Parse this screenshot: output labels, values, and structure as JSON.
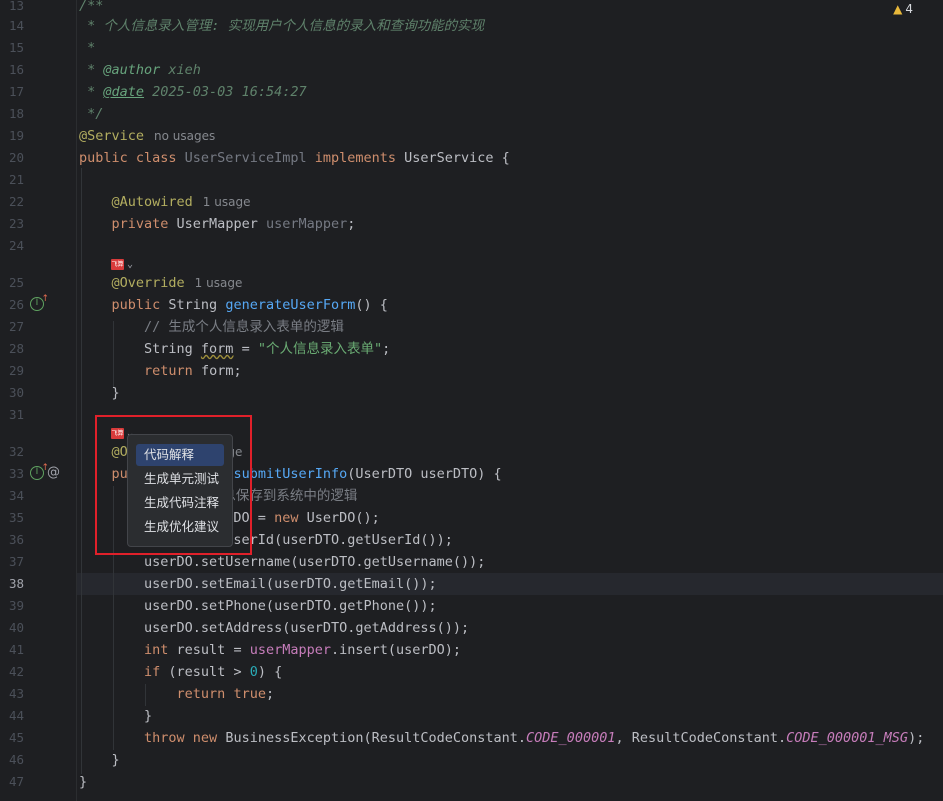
{
  "problems": {
    "count": "4"
  },
  "lines": [
    {
      "n": "13",
      "html": "<span class='doc'>/**</span>"
    },
    {
      "n": "14",
      "html": "<span class='doc'> * 个人信息录入管理: 实现用户个人信息的录入和查询功能的实现</span>"
    },
    {
      "n": "15",
      "html": "<span class='doc'> *</span>"
    },
    {
      "n": "16",
      "html": "<span class='doc'> * </span><span class='doctag' style='text-decoration:none'>@author</span><span class='docval'> xieh</span>"
    },
    {
      "n": "17",
      "html": "<span class='doc'> * </span><span class='doctag'>@date</span><span class='docval'> 2025-03-03 16:54:27</span>"
    },
    {
      "n": "18",
      "html": "<span class='doc'> */</span>"
    },
    {
      "n": "19",
      "html": "<span class='ann'>@Service</span><span class='hint'>no usages</span>"
    },
    {
      "n": "20",
      "html": "<span class='k'>public class </span><span class='fieldgrey'>UserServiceImpl</span><span class='k'> implements </span>UserService {"
    },
    {
      "n": "21",
      "html": ""
    },
    {
      "n": "22",
      "html": "    <span class='ann'>@Autowired</span><span class='hint'>1 usage</span>"
    },
    {
      "n": "23",
      "html": "    <span class='k'>private </span>UserMapper <span class='fieldgrey'>userMapper</span>;"
    },
    {
      "n": "24",
      "html": ""
    },
    {
      "n": "25",
      "html": "    <span class='ann'>@Override</span><span class='hint'>1 usage</span>"
    },
    {
      "n": "26",
      "html": "    <span class='k'>public </span>String <span class='fn'>generateUserForm</span>() {"
    },
    {
      "n": "27",
      "html": "        <span class='cm'>// 生成个人信息录入表单的逻辑</span>"
    },
    {
      "n": "28",
      "html": "        String <span class='wavy'>form</span> = <span class='str'>\"个人信息录入表单\"</span>;"
    },
    {
      "n": "29",
      "html": "        <span class='k'>return </span>form;"
    },
    {
      "n": "30",
      "html": "    }"
    },
    {
      "n": "31",
      "html": ""
    },
    {
      "n": "32",
      "html": "    <span class='ann'>@Override</span><span class='hint'>1 usage</span>"
    },
    {
      "n": "33",
      "html": "    <span class='k'>public boolean </span><span class='fn'>submitUserInfo</span>(UserDTO userDTO) {"
    },
    {
      "n": "34",
      "html": "        <span class='cm'>// 将用户信息保存到系统中的逻辑</span>"
    },
    {
      "n": "35",
      "html": "        UserDO userDO = <span class='k'>new </span>UserDO();"
    },
    {
      "n": "36",
      "html": "        userDO.setUserId(userDTO.getUserId());"
    },
    {
      "n": "37",
      "html": "        userDO.setUsername(userDTO.getUsername());"
    },
    {
      "n": "38",
      "html": "        userDO.setEmail(userDTO.getEmail());"
    },
    {
      "n": "39",
      "html": "        userDO.setPhone(userDTO.getPhone());"
    },
    {
      "n": "40",
      "html": "        userDO.setAddress(userDTO.getAddress());"
    },
    {
      "n": "41",
      "html": "        <span class='k'>int </span>result = <span class='field'>userMapper</span>.insert(userDO);"
    },
    {
      "n": "42",
      "html": "        <span class='k'>if </span>(result > <span class='num'>0</span>) {"
    },
    {
      "n": "43",
      "html": "            <span class='k'>return true</span>;"
    },
    {
      "n": "44",
      "html": "        }"
    },
    {
      "n": "45",
      "html": "        <span class='k'>throw new </span>BusinessException(ResultCodeConstant.<span class='const'>CODE_000001</span>, ResultCodeConstant.<span class='const'>CODE_000001_MSG</span>);"
    },
    {
      "n": "46",
      "html": "    }"
    },
    {
      "n": "47",
      "html": "}"
    }
  ],
  "plugin_badge": "飞算",
  "menu": {
    "items": [
      "代码解释",
      "生成单元测试",
      "生成代码注释",
      "生成优化建议"
    ],
    "selected_index": 0
  }
}
